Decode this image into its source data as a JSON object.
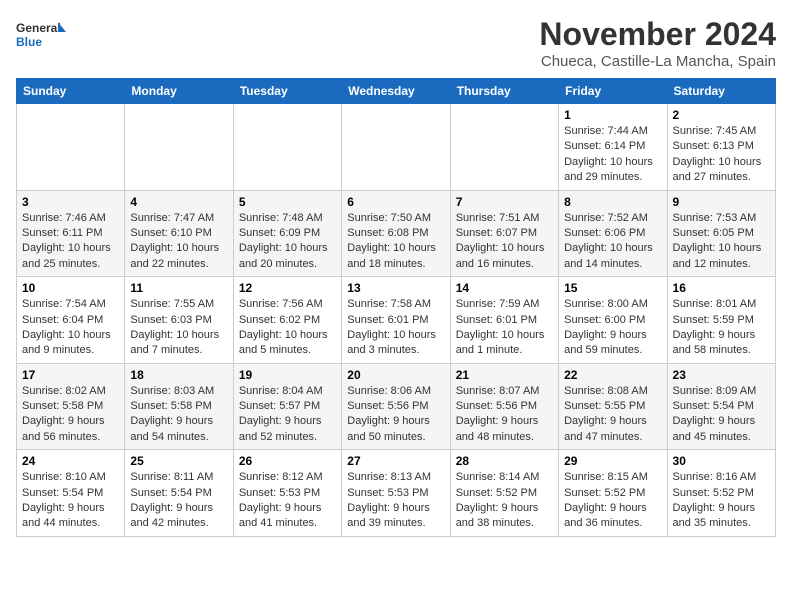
{
  "header": {
    "logo_line1": "General",
    "logo_line2": "Blue",
    "month_title": "November 2024",
    "location": "Chueca, Castille-La Mancha, Spain"
  },
  "weekdays": [
    "Sunday",
    "Monday",
    "Tuesday",
    "Wednesday",
    "Thursday",
    "Friday",
    "Saturday"
  ],
  "weeks": [
    [
      {
        "day": "",
        "info": ""
      },
      {
        "day": "",
        "info": ""
      },
      {
        "day": "",
        "info": ""
      },
      {
        "day": "",
        "info": ""
      },
      {
        "day": "",
        "info": ""
      },
      {
        "day": "1",
        "info": "Sunrise: 7:44 AM\nSunset: 6:14 PM\nDaylight: 10 hours and 29 minutes."
      },
      {
        "day": "2",
        "info": "Sunrise: 7:45 AM\nSunset: 6:13 PM\nDaylight: 10 hours and 27 minutes."
      }
    ],
    [
      {
        "day": "3",
        "info": "Sunrise: 7:46 AM\nSunset: 6:11 PM\nDaylight: 10 hours and 25 minutes."
      },
      {
        "day": "4",
        "info": "Sunrise: 7:47 AM\nSunset: 6:10 PM\nDaylight: 10 hours and 22 minutes."
      },
      {
        "day": "5",
        "info": "Sunrise: 7:48 AM\nSunset: 6:09 PM\nDaylight: 10 hours and 20 minutes."
      },
      {
        "day": "6",
        "info": "Sunrise: 7:50 AM\nSunset: 6:08 PM\nDaylight: 10 hours and 18 minutes."
      },
      {
        "day": "7",
        "info": "Sunrise: 7:51 AM\nSunset: 6:07 PM\nDaylight: 10 hours and 16 minutes."
      },
      {
        "day": "8",
        "info": "Sunrise: 7:52 AM\nSunset: 6:06 PM\nDaylight: 10 hours and 14 minutes."
      },
      {
        "day": "9",
        "info": "Sunrise: 7:53 AM\nSunset: 6:05 PM\nDaylight: 10 hours and 12 minutes."
      }
    ],
    [
      {
        "day": "10",
        "info": "Sunrise: 7:54 AM\nSunset: 6:04 PM\nDaylight: 10 hours and 9 minutes."
      },
      {
        "day": "11",
        "info": "Sunrise: 7:55 AM\nSunset: 6:03 PM\nDaylight: 10 hours and 7 minutes."
      },
      {
        "day": "12",
        "info": "Sunrise: 7:56 AM\nSunset: 6:02 PM\nDaylight: 10 hours and 5 minutes."
      },
      {
        "day": "13",
        "info": "Sunrise: 7:58 AM\nSunset: 6:01 PM\nDaylight: 10 hours and 3 minutes."
      },
      {
        "day": "14",
        "info": "Sunrise: 7:59 AM\nSunset: 6:01 PM\nDaylight: 10 hours and 1 minute."
      },
      {
        "day": "15",
        "info": "Sunrise: 8:00 AM\nSunset: 6:00 PM\nDaylight: 9 hours and 59 minutes."
      },
      {
        "day": "16",
        "info": "Sunrise: 8:01 AM\nSunset: 5:59 PM\nDaylight: 9 hours and 58 minutes."
      }
    ],
    [
      {
        "day": "17",
        "info": "Sunrise: 8:02 AM\nSunset: 5:58 PM\nDaylight: 9 hours and 56 minutes."
      },
      {
        "day": "18",
        "info": "Sunrise: 8:03 AM\nSunset: 5:58 PM\nDaylight: 9 hours and 54 minutes."
      },
      {
        "day": "19",
        "info": "Sunrise: 8:04 AM\nSunset: 5:57 PM\nDaylight: 9 hours and 52 minutes."
      },
      {
        "day": "20",
        "info": "Sunrise: 8:06 AM\nSunset: 5:56 PM\nDaylight: 9 hours and 50 minutes."
      },
      {
        "day": "21",
        "info": "Sunrise: 8:07 AM\nSunset: 5:56 PM\nDaylight: 9 hours and 48 minutes."
      },
      {
        "day": "22",
        "info": "Sunrise: 8:08 AM\nSunset: 5:55 PM\nDaylight: 9 hours and 47 minutes."
      },
      {
        "day": "23",
        "info": "Sunrise: 8:09 AM\nSunset: 5:54 PM\nDaylight: 9 hours and 45 minutes."
      }
    ],
    [
      {
        "day": "24",
        "info": "Sunrise: 8:10 AM\nSunset: 5:54 PM\nDaylight: 9 hours and 44 minutes."
      },
      {
        "day": "25",
        "info": "Sunrise: 8:11 AM\nSunset: 5:54 PM\nDaylight: 9 hours and 42 minutes."
      },
      {
        "day": "26",
        "info": "Sunrise: 8:12 AM\nSunset: 5:53 PM\nDaylight: 9 hours and 41 minutes."
      },
      {
        "day": "27",
        "info": "Sunrise: 8:13 AM\nSunset: 5:53 PM\nDaylight: 9 hours and 39 minutes."
      },
      {
        "day": "28",
        "info": "Sunrise: 8:14 AM\nSunset: 5:52 PM\nDaylight: 9 hours and 38 minutes."
      },
      {
        "day": "29",
        "info": "Sunrise: 8:15 AM\nSunset: 5:52 PM\nDaylight: 9 hours and 36 minutes."
      },
      {
        "day": "30",
        "info": "Sunrise: 8:16 AM\nSunset: 5:52 PM\nDaylight: 9 hours and 35 minutes."
      }
    ]
  ]
}
